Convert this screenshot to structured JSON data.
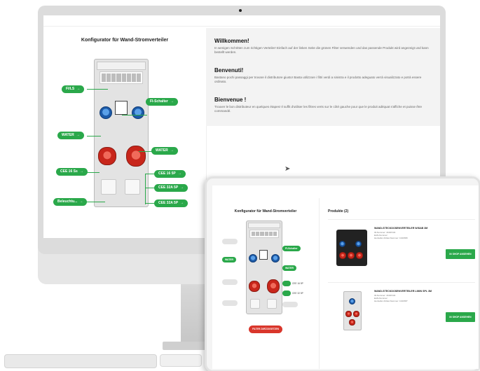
{
  "desktop": {
    "configurator_title": "Konfigurator für Wand-Stromverteiler",
    "labels": {
      "fi_ls": "FI/LS",
      "fi_schalter": "FI-Schalter",
      "water_left": "WATER",
      "water_right": "WATER",
      "cee16_left": "CEE 16 Ss",
      "cee16_right": "CEE 16 5P",
      "cee32_upper": "CEE 32A 5P",
      "cee32_lower": "CEE 32A 5P",
      "schuko": "Beleuchtu..."
    },
    "sections": [
      {
        "heading": "Willkommen!",
        "text": "In wenigen Schritten zum richtigen Verteiler! Einfach auf der linken Seite die grünen Filter verwenden und das passende Produkt wird angezeigt und kann bestellt werden."
      },
      {
        "heading": "Benvenuti!",
        "text": "Bastano pochi passaggi per trovare il distributore giusto! Basta utilizzare i filtri verdi a sinistra e il prodotto adeguato verrà visualizzato e potrà essere ordinato."
      },
      {
        "heading": "Bienvenue !",
        "text": "Trouver le bon distributeur en quelques étapes! Il suffit d'utiliser les filtres verts sur le côté gauche pour que le produit adéquat s'affiche et puisse être commandé."
      }
    ]
  },
  "tablet": {
    "configurator_title": "Konfigurator für Wand-Stromverteiler",
    "products_title": "Produkte (2)",
    "labels": {
      "fi_schalter": "FI-Schalter",
      "water_left": "WATER",
      "water_right": "WATER",
      "cee16": "CEE 16 5P",
      "cee32": "CEE 32 5P"
    },
    "reset_button": "FILTER ZURÜCKSETZEN",
    "products": [
      {
        "name": "WAND-STECKDOSENVERTEILER WISAB 3M",
        "meta": "ID-Nummer: 4K/4P/4/4\nEAN-Nummer: \nHersteller Artikel-Nummer: 1341580",
        "button": "IN SHOP ANSEHEN"
      },
      {
        "name": "WAND-STECKDOSENVERTEILER LIMIN SPL 3M",
        "meta": "ID-Nummer: 4K/4P/4/4\nEAN-Nummer: \nHersteller Artikel-Nummer: 1341587",
        "button": "IN SHOP ANSEHEN"
      }
    ]
  },
  "colors": {
    "accent_green": "#2aa84a",
    "accent_red": "#d9362b",
    "socket_blue": "#1c5aa8",
    "socket_red": "#c8261b"
  }
}
